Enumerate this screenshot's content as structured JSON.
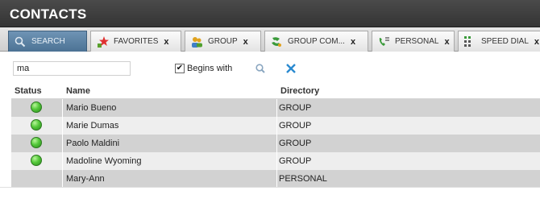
{
  "window": {
    "title": "CONTACTS"
  },
  "tabs": [
    {
      "label": "SEARCH",
      "icon": "search-icon",
      "closable": false
    },
    {
      "label": "FAVORITES",
      "icon": "star-icon",
      "closable": true
    },
    {
      "label": "GROUP",
      "icon": "group-icon",
      "closable": true
    },
    {
      "label": "GROUP COM...",
      "icon": "group-common-icon",
      "closable": true
    },
    {
      "label": "PERSONAL",
      "icon": "personal-phone-icon",
      "closable": true
    },
    {
      "label": "SPEED DIAL",
      "icon": "keypad-icon",
      "closable": true
    }
  ],
  "tab_close_glyph": "x",
  "search": {
    "query": "ma",
    "begins_with_label": "Begins with",
    "begins_with_checked": true,
    "checkbox_glyph": "✔"
  },
  "columns": {
    "status": "Status",
    "name": "Name",
    "directory": "Directory"
  },
  "rows": [
    {
      "status": "available",
      "name": "Mario Bueno",
      "directory": "GROUP"
    },
    {
      "status": "available",
      "name": "Marie Dumas",
      "directory": "GROUP"
    },
    {
      "status": "available",
      "name": "Paolo Maldini",
      "directory": "GROUP"
    },
    {
      "status": "available",
      "name": "Madoline Wyoming",
      "directory": "GROUP"
    },
    {
      "status": "",
      "name": "Mary-Ann",
      "directory": "PERSONAL"
    }
  ],
  "colors": {
    "titlebar": "#3a3a3a",
    "active_tab": "#5b83a6",
    "status_available": "#4cc236",
    "row_odd": "#d2d2d2",
    "row_even": "#eeeeee"
  }
}
